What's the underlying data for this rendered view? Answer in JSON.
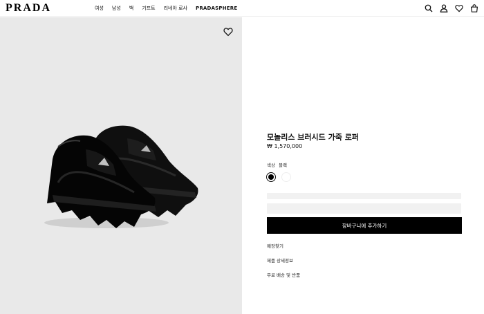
{
  "header": {
    "logo": "PRADA",
    "nav": [
      "여성",
      "남성",
      "백",
      "기프트",
      "리네아 로사",
      "PRADASPHERE"
    ],
    "icons": [
      "search-icon",
      "account-icon",
      "wishlist-icon",
      "bag-icon"
    ]
  },
  "product": {
    "title": "모놀리스 브러시드 가죽 로퍼",
    "price": "₩ 1,570,000",
    "color_label": "색상",
    "color_value": "블랙",
    "swatches": [
      {
        "name": "black",
        "color": "#000000",
        "selected": true
      },
      {
        "name": "white",
        "color": "#ffffff",
        "selected": false
      }
    ],
    "add_to_cart": "장바구니에 추가하기",
    "links": [
      "매장찾기",
      "제품 상세정보",
      "무료 배송 및 반품"
    ]
  },
  "colors": {
    "accent": "#000000",
    "image_bg": "#e9e9e9",
    "skeleton": "#f1f1f1"
  }
}
